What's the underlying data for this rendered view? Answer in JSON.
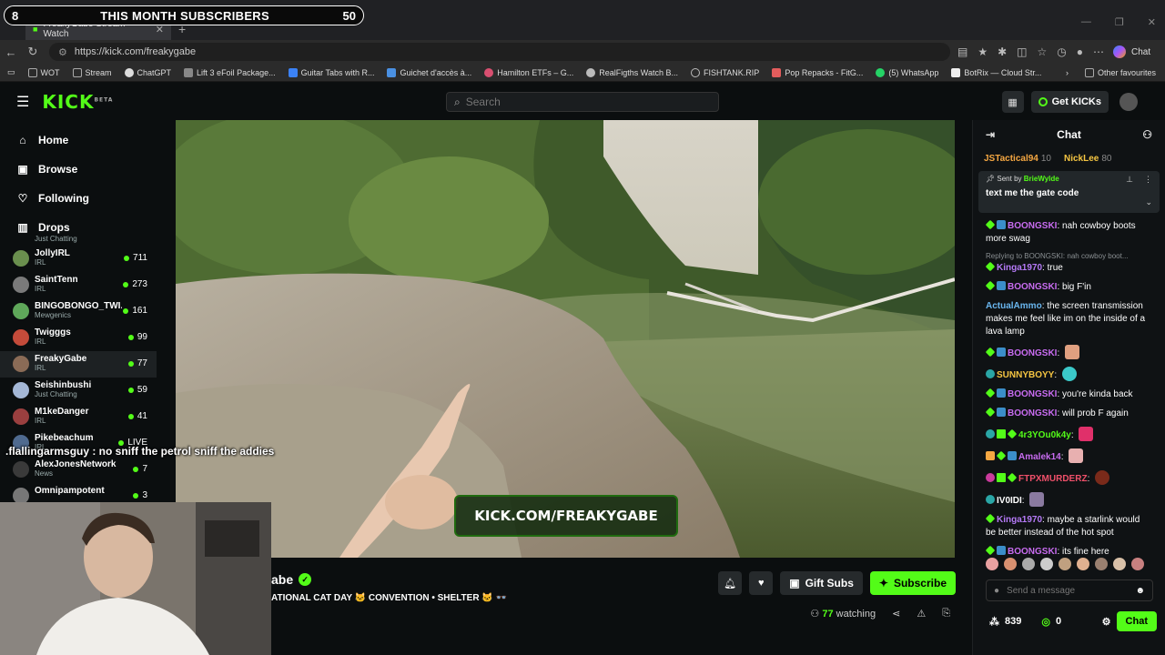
{
  "overlay_banner": {
    "left_num": "8",
    "title": "THIS MONTH SUBSCRIBERS",
    "right_num": "50"
  },
  "browser": {
    "tab_title": "FreakyGabe Stream - Watch",
    "url": "https://kick.com/freakygabe",
    "copilot_label": "Chat",
    "bookmarks": [
      "WOT",
      "Stream",
      "ChatGPT",
      "Lift 3 eFoil Package...",
      "Guitar Tabs with R...",
      "Guichet d'accès à...",
      "Hamilton ETFs – G...",
      "RealFigths Watch B...",
      "FISHTANK.RIP",
      "Pop Repacks - FitG...",
      "(5) WhatsApp",
      "BotRix — Cloud Str..."
    ],
    "other_bookmarks": "Other favourites"
  },
  "header": {
    "logo": "KICK",
    "logo_tag": "BETA",
    "search_placeholder": "Search",
    "get_kicks": "Get KICKs"
  },
  "sidebar": {
    "nav": [
      {
        "label": "Home",
        "icon": "home-icon"
      },
      {
        "label": "Browse",
        "icon": "browse-icon"
      },
      {
        "label": "Following",
        "icon": "heart-icon"
      },
      {
        "label": "Drops",
        "icon": "drops-icon"
      }
    ],
    "top_category": "Just Chatting",
    "channels": [
      {
        "name": "JollyIRL",
        "category": "IRL",
        "viewers": "711",
        "color": "#6a8f4e"
      },
      {
        "name": "SaintTenn",
        "category": "IRL",
        "viewers": "273",
        "color": "#7a7a7a"
      },
      {
        "name": "BINGOBONGO_TWI...",
        "category": "Mewgenics",
        "viewers": "161",
        "color": "#5fa85a"
      },
      {
        "name": "Twigggs",
        "category": "IRL",
        "viewers": "99",
        "color": "#c44b3a"
      },
      {
        "name": "FreakyGabe",
        "category": "IRL",
        "viewers": "77",
        "color": "#8a6b56"
      },
      {
        "name": "Seishinbushi",
        "category": "Just Chatting",
        "viewers": "59",
        "color": "#a4b7d6"
      },
      {
        "name": "M1keDanger",
        "category": "IRL",
        "viewers": "41",
        "color": "#9a3f3f"
      },
      {
        "name": "Pikebeachum",
        "category": "IRL",
        "viewers": "LIVE",
        "color": "#4f6a8f"
      },
      {
        "name": "AlexJonesNetwork",
        "category": "News",
        "viewers": "7",
        "color": "#3a3a3a"
      },
      {
        "name": "Omnipampotent",
        "category": "",
        "viewers": "3",
        "color": "#777777"
      }
    ]
  },
  "overlay_chat": ".flallingarmsguy : no sniff the petrol sniff the addies",
  "video": {
    "watermark": "KICK.COM/FREAKYGABE"
  },
  "stream": {
    "streamer": "abe",
    "title": "ATIONAL CAT DAY 🐱 CONVENTION • SHELTER 🐱 👓",
    "gift_subs": "Gift Subs",
    "subscribe": "Subscribe",
    "watching": "77",
    "watching_label": "watching"
  },
  "chat": {
    "title": "Chat",
    "leaders": [
      {
        "name": "JSTactical94",
        "count": "10"
      },
      {
        "name": "NickLee",
        "count": "80"
      }
    ],
    "pinned": {
      "sent_by": "Sent by",
      "author": "BrieWylde",
      "message": "text me the gate code"
    },
    "messages": [
      {
        "user": "BOONGSKI",
        "color": "#c86cf0",
        "text": "nah cowboy boots more swag",
        "badges": [
          "diamond",
          "x"
        ]
      },
      {
        "reply": "Replying to BOONGSKI: nah cowboy boot...",
        "user": "Kinga1970",
        "color": "#b57af7",
        "text": "true",
        "badges": [
          "diamond"
        ]
      },
      {
        "user": "BOONGSKI",
        "color": "#c86cf0",
        "text": "big F'in",
        "badges": [
          "diamond",
          "x"
        ]
      },
      {
        "user": "ActualAmmo",
        "color": "#6ab7f0",
        "text": "the screen transmission makes me feel like im on the inside of a lava lamp",
        "badges": []
      },
      {
        "user": "BOONGSKI",
        "color": "#c86cf0",
        "text": "",
        "badges": [
          "diamond",
          "x"
        ],
        "emote": "#e0a080"
      },
      {
        "user": "SUNNYBOYY",
        "color": "#f5c542",
        "text": "",
        "badges": [
          "sub"
        ],
        "emote": "#3bc9c9"
      },
      {
        "user": "BOONGSKI",
        "color": "#c86cf0",
        "text": "you're kinda back",
        "badges": [
          "diamond",
          "x"
        ]
      },
      {
        "user": "BOONGSKI",
        "color": "#c86cf0",
        "text": "will prob F again",
        "badges": [
          "diamond",
          "x"
        ]
      },
      {
        "user": "4r3YOu0k4y",
        "color": "#53fc18",
        "text": "",
        "badges": [
          "sub",
          "gift",
          "diamond"
        ],
        "emote": "#e0306a"
      },
      {
        "user": "Amalek14",
        "color": "#c86cf0",
        "text": "",
        "badges": [
          "crown",
          "diamond",
          "x"
        ],
        "emote": "#e8b0b0"
      },
      {
        "user": "FTPXMURDERZ",
        "color": "#f0506a",
        "text": "",
        "badges": [
          "pink",
          "gift",
          "diamond"
        ],
        "emote": "#7a2a1a"
      },
      {
        "user": "IV0IDI",
        "color": "#ffffff",
        "text": "",
        "badges": [
          "sub"
        ],
        "emote": "#8a7aa0"
      },
      {
        "user": "Kinga1970",
        "color": "#b57af7",
        "text": "maybe a starlink would be better instead of the hot spot",
        "badges": [
          "diamond"
        ]
      },
      {
        "user": "BOONGSKI",
        "color": "#c86cf0",
        "text": "its fine here",
        "badges": [
          "diamond",
          "x"
        ]
      }
    ],
    "send_placeholder": "Send a message",
    "points": "839",
    "kicks": "0",
    "chat_button": "Chat"
  }
}
